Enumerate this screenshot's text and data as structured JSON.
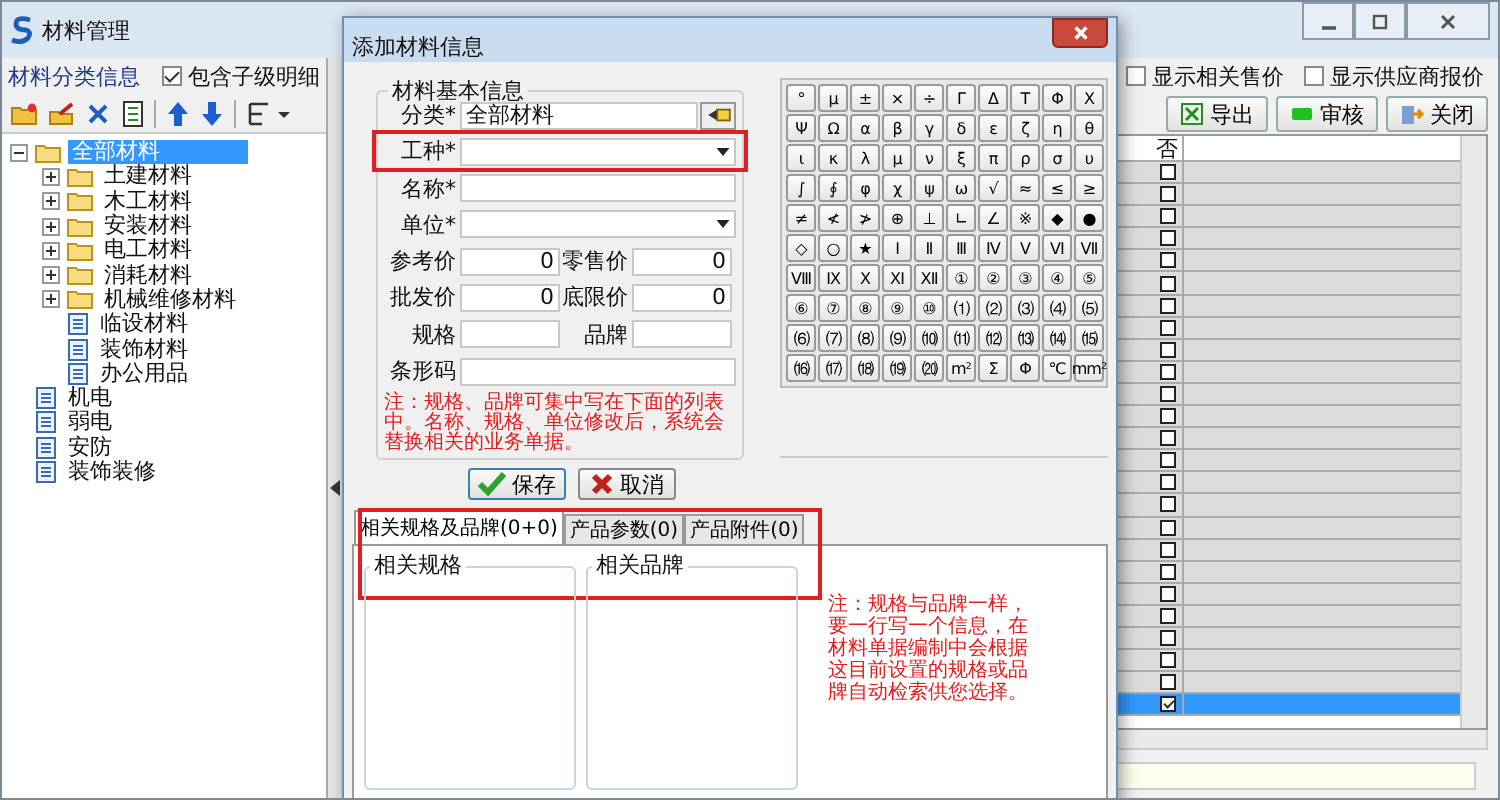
{
  "window": {
    "title": "材料管理"
  },
  "category_panel": {
    "title": "材料分类信息",
    "include_children": {
      "label": "包含子级明细",
      "checked": true
    }
  },
  "tree": [
    {
      "label": "全部材料",
      "kind": "folder",
      "expanded": true,
      "selected": true,
      "children": [
        {
          "label": "土建材料",
          "kind": "folder",
          "expanded": false,
          "selected": false
        },
        {
          "label": "木工材料",
          "kind": "folder",
          "expanded": false,
          "selected": false
        },
        {
          "label": "安装材料",
          "kind": "folder",
          "expanded": false,
          "selected": false
        },
        {
          "label": "电工材料",
          "kind": "folder",
          "expanded": false,
          "selected": false
        },
        {
          "label": "消耗材料",
          "kind": "folder",
          "expanded": false,
          "selected": false
        },
        {
          "label": "机械维修材料",
          "kind": "folder",
          "expanded": false,
          "selected": false
        },
        {
          "label": "临设材料",
          "kind": "item",
          "selected": false
        },
        {
          "label": "装饰材料",
          "kind": "item",
          "selected": false
        },
        {
          "label": "办公用品",
          "kind": "item",
          "selected": false
        }
      ]
    },
    {
      "label": "机电",
      "kind": "item",
      "selected": false
    },
    {
      "label": "弱电",
      "kind": "item",
      "selected": false
    },
    {
      "label": "安防",
      "kind": "item",
      "selected": false
    },
    {
      "label": "装饰装修",
      "kind": "item",
      "selected": false
    }
  ],
  "options": [
    {
      "label": "显示相关售价",
      "checked": false
    },
    {
      "label": "显示供应商报价",
      "checked": false
    }
  ],
  "toolbar": [
    {
      "label": "导出",
      "kind": "export"
    },
    {
      "label": "审核",
      "kind": "approve"
    },
    {
      "label": "关闭",
      "kind": "close"
    }
  ],
  "grid": {
    "column": "否",
    "rows": [
      {
        "checked": false,
        "selected": false
      },
      {
        "checked": false,
        "selected": false
      },
      {
        "checked": false,
        "selected": false
      },
      {
        "checked": false,
        "selected": false
      },
      {
        "checked": false,
        "selected": false
      },
      {
        "checked": false,
        "selected": false
      },
      {
        "checked": false,
        "selected": false
      },
      {
        "checked": false,
        "selected": false
      },
      {
        "checked": false,
        "selected": false
      },
      {
        "checked": false,
        "selected": false
      },
      {
        "checked": false,
        "selected": false
      },
      {
        "checked": false,
        "selected": false
      },
      {
        "checked": false,
        "selected": false
      },
      {
        "checked": false,
        "selected": false
      },
      {
        "checked": false,
        "selected": false
      },
      {
        "checked": false,
        "selected": false
      },
      {
        "checked": false,
        "selected": false
      },
      {
        "checked": false,
        "selected": false
      },
      {
        "checked": false,
        "selected": false
      },
      {
        "checked": false,
        "selected": false
      },
      {
        "checked": false,
        "selected": false
      },
      {
        "checked": false,
        "selected": false
      },
      {
        "checked": false,
        "selected": false
      },
      {
        "checked": false,
        "selected": false
      },
      {
        "checked": true,
        "selected": true
      }
    ]
  },
  "dialog": {
    "title": "添加材料信息",
    "group_title": "材料基本信息",
    "fields": [
      {
        "label": "分类*",
        "value": "全部材料",
        "kind": "picker",
        "highlighted": false
      },
      {
        "label": "工种*",
        "kind": "dropdown",
        "highlighted": true
      },
      {
        "label": "名称*",
        "kind": "text",
        "highlighted": false
      },
      {
        "label": "单位*",
        "kind": "dropdown",
        "highlighted": false
      }
    ],
    "pair_rows": [
      [
        {
          "label": "参考价",
          "value": "0"
        },
        {
          "label": "零售价",
          "value": "0"
        }
      ],
      [
        {
          "label": "批发价",
          "value": "0"
        },
        {
          "label": "底限价",
          "value": "0"
        }
      ],
      [
        {
          "label": "规格"
        },
        {
          "label": "品牌"
        }
      ]
    ],
    "barcode": {
      "label": "条形码"
    },
    "note": "注：规格、品牌可集中写在下面的列表中。名称、规格、单位修改后，系统会替换相关的业务单据。",
    "buttons": [
      {
        "label": "保存",
        "kind": "save"
      },
      {
        "label": "取消",
        "kind": "cancel"
      }
    ],
    "symbols": [
      "°",
      "μ",
      "±",
      "×",
      "÷",
      "Γ",
      "Δ",
      "Τ",
      "Φ",
      "Χ",
      "Ψ",
      "Ω",
      "α",
      "β",
      "γ",
      "δ",
      "ε",
      "ζ",
      "η",
      "θ",
      "ι",
      "κ",
      "λ",
      "μ",
      "ν",
      "ξ",
      "π",
      "ρ",
      "σ",
      "υ",
      "∫",
      "∮",
      "φ",
      "χ",
      "ψ",
      "ω",
      "√",
      "≈",
      "≤",
      "≥",
      "≠",
      "≮",
      "≯",
      "⊕",
      "⊥",
      "∟",
      "∠",
      "※",
      "◆",
      "●",
      "◇",
      "○",
      "★",
      "Ⅰ",
      "Ⅱ",
      "Ⅲ",
      "Ⅳ",
      "Ⅴ",
      "Ⅵ",
      "Ⅶ",
      "Ⅷ",
      "Ⅸ",
      "Ⅹ",
      "Ⅺ",
      "Ⅻ",
      "①",
      "②",
      "③",
      "④",
      "⑤",
      "⑥",
      "⑦",
      "⑧",
      "⑨",
      "⑩",
      "⑴",
      "⑵",
      "⑶",
      "⑷",
      "⑸",
      "⑹",
      "⑺",
      "⑻",
      "⑼",
      "⑽",
      "⑾",
      "⑿",
      "⒀",
      "⒁",
      "⒂",
      "⒃",
      "⒄",
      "⒅",
      "⒆",
      "⒇",
      "m²",
      "Σ",
      "Φ",
      "℃",
      "mm²"
    ],
    "tabs_highlighted": true,
    "tabs": [
      {
        "label": "相关规格及品牌(0+0)",
        "selected": true
      },
      {
        "label": "产品参数(0)",
        "selected": false
      },
      {
        "label": "产品附件(0)",
        "selected": false
      }
    ],
    "spec_list": {
      "title": "相关规格"
    },
    "brand_list": {
      "title": "相关品牌"
    },
    "tab_note": "注：规格与品牌一样，要一行写一个信息，在材料单据编制中会根据这目前设置的规格或品牌自动检索供您选择。"
  }
}
